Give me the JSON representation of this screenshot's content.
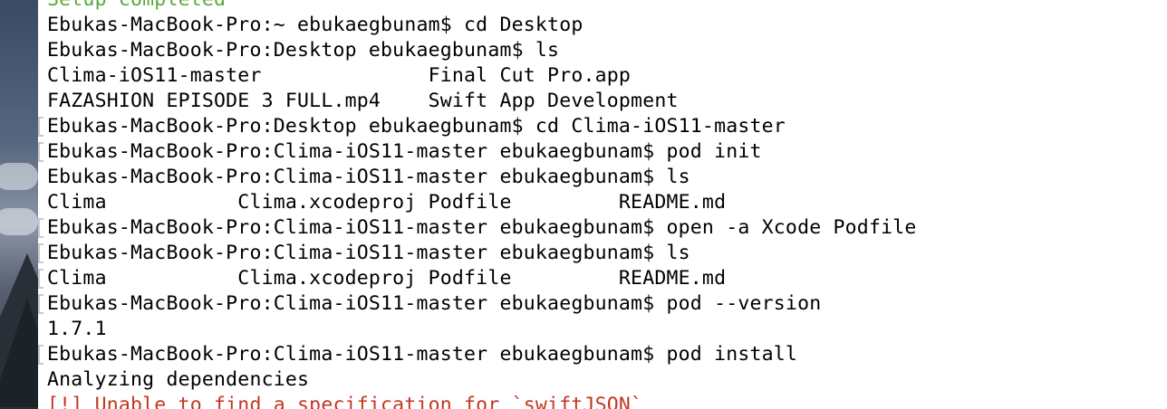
{
  "terminal": {
    "lines": [
      {
        "text": "Setup completed",
        "style": "green",
        "marked": false
      },
      {
        "text": "Ebukas-MacBook-Pro:~ ebukaegbunam$ cd Desktop",
        "style": "normal",
        "marked": false
      },
      {
        "text": "Ebukas-MacBook-Pro:Desktop ebukaegbunam$ ls",
        "style": "normal",
        "marked": false
      },
      {
        "text": "Clima-iOS11-master              Final Cut Pro.app",
        "style": "normal",
        "marked": false
      },
      {
        "text": "FAZASHION EPISODE 3 FULL.mp4    Swift App Development",
        "style": "normal",
        "marked": false
      },
      {
        "text": "Ebukas-MacBook-Pro:Desktop ebukaegbunam$ cd Clima-iOS11-master",
        "style": "normal",
        "marked": true
      },
      {
        "text": "Ebukas-MacBook-Pro:Clima-iOS11-master ebukaegbunam$ pod init",
        "style": "normal",
        "marked": true
      },
      {
        "text": "Ebukas-MacBook-Pro:Clima-iOS11-master ebukaegbunam$ ls",
        "style": "normal",
        "marked": false
      },
      {
        "text": "Clima           Clima.xcodeproj Podfile         README.md",
        "style": "normal",
        "marked": false
      },
      {
        "text": "Ebukas-MacBook-Pro:Clima-iOS11-master ebukaegbunam$ open -a Xcode Podfile",
        "style": "normal",
        "marked": true
      },
      {
        "text": "Ebukas-MacBook-Pro:Clima-iOS11-master ebukaegbunam$ ls",
        "style": "normal",
        "marked": true
      },
      {
        "text": "Clima           Clima.xcodeproj Podfile         README.md",
        "style": "normal",
        "marked": true
      },
      {
        "text": "Ebukas-MacBook-Pro:Clima-iOS11-master ebukaegbunam$ pod --version",
        "style": "normal",
        "marked": true
      },
      {
        "text": "1.7.1",
        "style": "normal",
        "marked": false
      },
      {
        "text": "Ebukas-MacBook-Pro:Clima-iOS11-master ebukaegbunam$ pod install",
        "style": "normal",
        "marked": true
      },
      {
        "text": "Analyzing dependencies",
        "style": "normal",
        "marked": false
      },
      {
        "text": "[!] Unable to find a specification for `swiftJSON`",
        "style": "red",
        "marked": false
      }
    ]
  },
  "colors": {
    "background": "#ffffff",
    "text": "#000000",
    "success": "#5aa839",
    "error": "#c23621"
  }
}
